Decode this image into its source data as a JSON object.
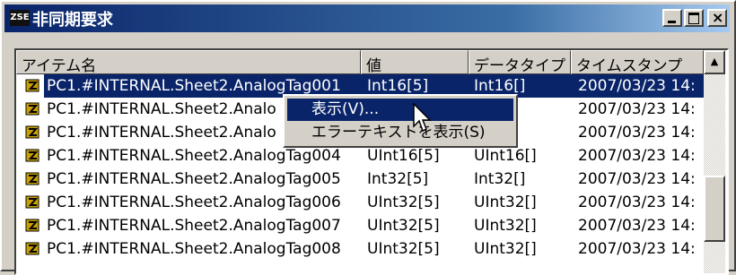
{
  "window": {
    "title": "非同期要求",
    "app_icon": "ZSE"
  },
  "columns": [
    "アイテム名",
    "値",
    "データタイプ",
    "タイムスタンプ"
  ],
  "rows": [
    {
      "name": "PC1.#INTERNAL.Sheet2.AnalogTag001",
      "value": "Int16[5]",
      "type": "Int16[]",
      "timestamp": "2007/03/23 14:",
      "selected": true
    },
    {
      "name": "PC1.#INTERNAL.Sheet2.Analo",
      "value": "",
      "type": "6[]",
      "timestamp": "2007/03/23 14:"
    },
    {
      "name": "PC1.#INTERNAL.Sheet2.Analo",
      "value": "",
      "type": "6[]",
      "timestamp": "2007/03/23 14:"
    },
    {
      "name": "PC1.#INTERNAL.Sheet2.AnalogTag004",
      "value": "UInt16[5]",
      "type": "UInt16[]",
      "timestamp": "2007/03/23 14:"
    },
    {
      "name": "PC1.#INTERNAL.Sheet2.AnalogTag005",
      "value": "Int32[5]",
      "type": "Int32[]",
      "timestamp": "2007/03/23 14:"
    },
    {
      "name": "PC1.#INTERNAL.Sheet2.AnalogTag006",
      "value": "UInt32[5]",
      "type": "UInt32[]",
      "timestamp": "2007/03/23 14:"
    },
    {
      "name": "PC1.#INTERNAL.Sheet2.AnalogTag007",
      "value": "UInt32[5]",
      "type": "UInt32[]",
      "timestamp": "2007/03/23 14:"
    },
    {
      "name": "PC1.#INTERNAL.Sheet2.AnalogTag008",
      "value": "UInt32[5]",
      "type": "UInt32[]",
      "timestamp": "2007/03/23 14:"
    }
  ],
  "context_menu": {
    "items": [
      "表示(V)...",
      "エラーテキストを表示(S)"
    ]
  },
  "colors": {
    "selection": "#0a246a",
    "face": "#d4d0c8"
  },
  "icons": {
    "row": "tag-icon",
    "title": "app-icon"
  }
}
